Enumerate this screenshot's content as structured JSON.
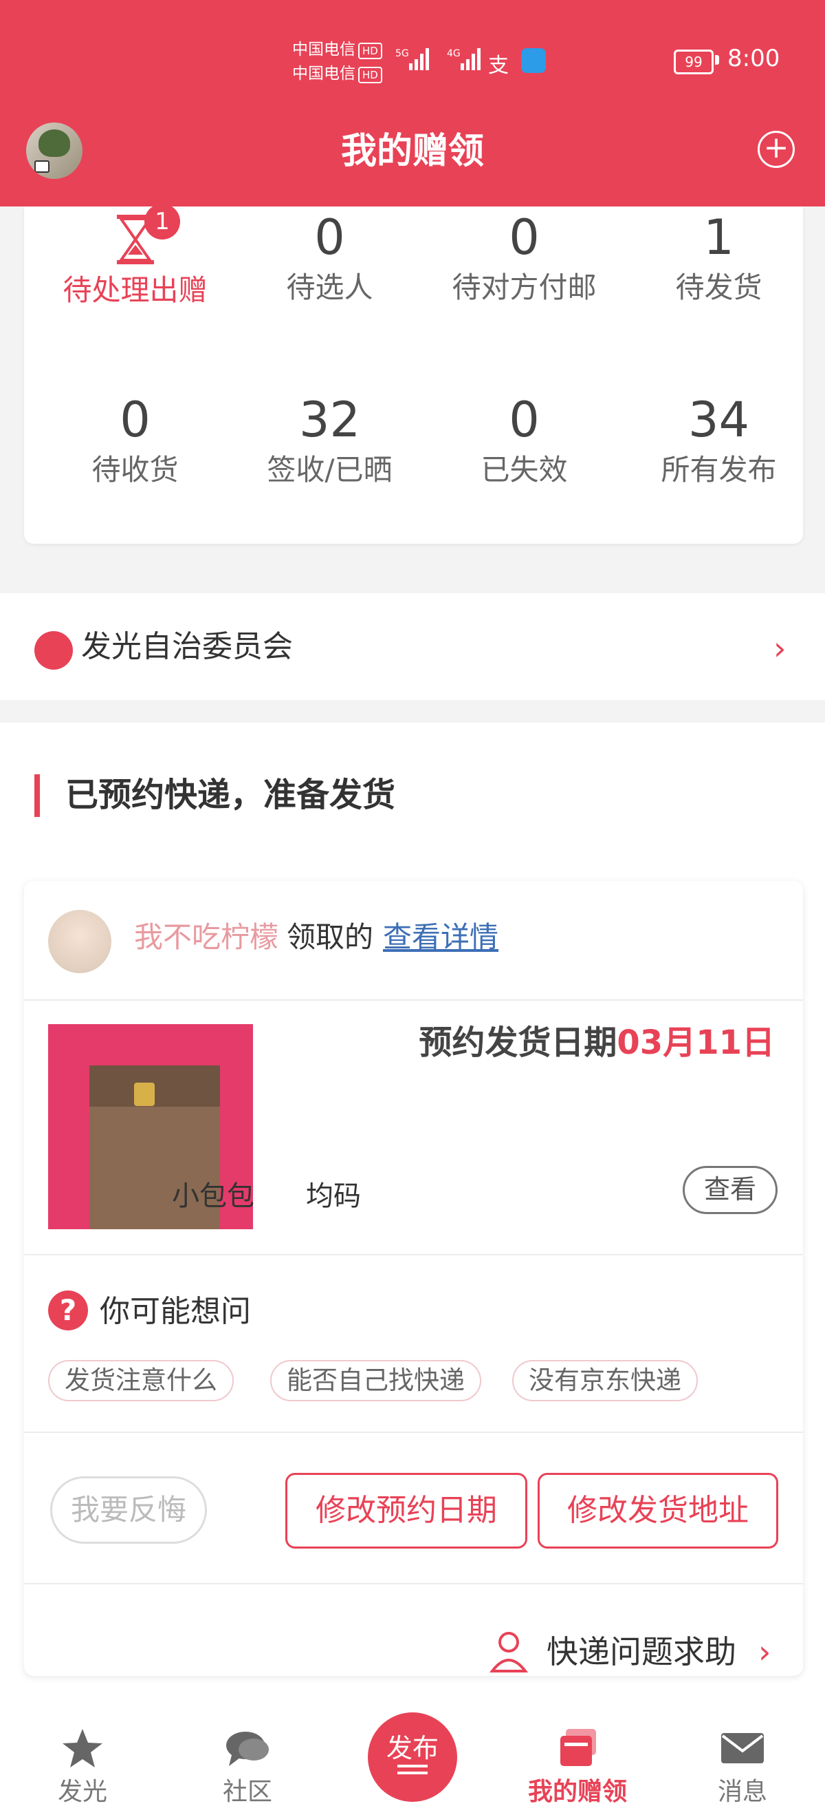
{
  "status_bar": {
    "carrier_1": "中国电信",
    "carrier_2": "中国电信",
    "hd": "HD",
    "battery": "99",
    "time": "8:00"
  },
  "header": {
    "title": "我的赠领",
    "avatar_icon": "avatar",
    "add_icon": "plus-circle-icon"
  },
  "stats": {
    "row1": [
      {
        "num": "",
        "label": "待处理出赠",
        "badge": "1"
      },
      {
        "num": "0",
        "label": "待选人"
      },
      {
        "num": "0",
        "label": "待对方付邮"
      },
      {
        "num": "1",
        "label": "待发货"
      }
    ],
    "row2": [
      {
        "num": "0",
        "label": "待收货"
      },
      {
        "num": "32",
        "label": "签收/已晒"
      },
      {
        "num": "0",
        "label": "已失效"
      },
      {
        "num": "34",
        "label": "所有发布"
      }
    ]
  },
  "committee": {
    "label": "发光自治委员会"
  },
  "section": {
    "title": "已预约快递，准备发货"
  },
  "order": {
    "user_name": "我不吃柠檬",
    "claimed_text": "领取的",
    "detail_link": "查看详情",
    "ship_label": "预约发货日期",
    "ship_date": "03月11日",
    "product_name": "小包包",
    "product_size": "均码",
    "view_button": "查看",
    "faq_title": "你可能想问",
    "faq_chips": [
      "发货注意什么",
      "能否自己找快递",
      "没有京东快递"
    ],
    "regret_button": "我要反悔",
    "change_date_button": "修改预约日期",
    "change_address_button": "修改发货地址",
    "help_label": "快递问题求助"
  },
  "nav": {
    "items": [
      {
        "label": "发光",
        "icon": "star-icon"
      },
      {
        "label": "社区",
        "icon": "chat-icon"
      },
      {
        "label": "发布",
        "icon": "publish-icon"
      },
      {
        "label": "我的赠领",
        "icon": "gift-cards-icon",
        "active": true
      },
      {
        "label": "消息",
        "icon": "mail-icon"
      }
    ]
  },
  "colors": {
    "accent": "#e84256",
    "link": "#3d6fb6"
  }
}
